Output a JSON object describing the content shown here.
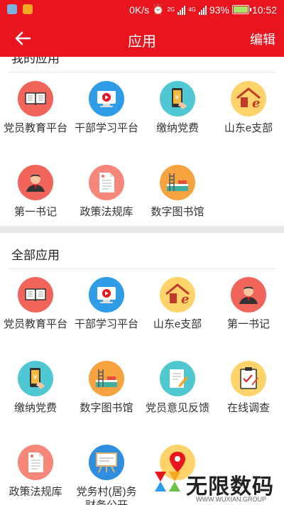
{
  "status_bar": {
    "speed": "0K/s",
    "network1": "2G",
    "network2": "4G",
    "battery": "93%",
    "time": "10:52",
    "battery_level": 0.93
  },
  "header": {
    "title": "应用",
    "edit_label": "编辑",
    "color": "#e8141e"
  },
  "my_apps": {
    "title": "我的应用",
    "items": [
      {
        "label": "党员教育平台",
        "icon": "book-icon"
      },
      {
        "label": "干部学习平台",
        "icon": "video-play-icon"
      },
      {
        "label": "缴纳党费",
        "icon": "phone-pay-icon"
      },
      {
        "label": "山东e支部",
        "icon": "house-e-icon"
      },
      {
        "label": "第一书记",
        "icon": "person-icon"
      },
      {
        "label": "政策法规库",
        "icon": "document-icon"
      },
      {
        "label": "数字图书馆",
        "icon": "library-icon"
      }
    ]
  },
  "all_apps": {
    "title": "全部应用",
    "items": [
      {
        "label": "党员教育平台",
        "icon": "book-icon"
      },
      {
        "label": "干部学习平台",
        "icon": "video-play-icon"
      },
      {
        "label": "山东e支部",
        "icon": "house-e-icon"
      },
      {
        "label": "第一书记",
        "icon": "person-icon"
      },
      {
        "label": "缴纳党费",
        "icon": "phone-pay-icon"
      },
      {
        "label": "数字图书馆",
        "icon": "library-icon"
      },
      {
        "label": "党员意见反馈",
        "icon": "pencil-doc-icon"
      },
      {
        "label": "在线调查",
        "icon": "clipboard-icon"
      },
      {
        "label": "政策法规库",
        "icon": "document-icon"
      },
      {
        "label": "党务村(居)务财务公开",
        "icon": "board-icon"
      },
      {
        "label": "",
        "icon": "location-icon"
      }
    ]
  },
  "watermark": {
    "title": "无限数码",
    "subtitle": "WWW.WUXIAN.GROUP"
  }
}
